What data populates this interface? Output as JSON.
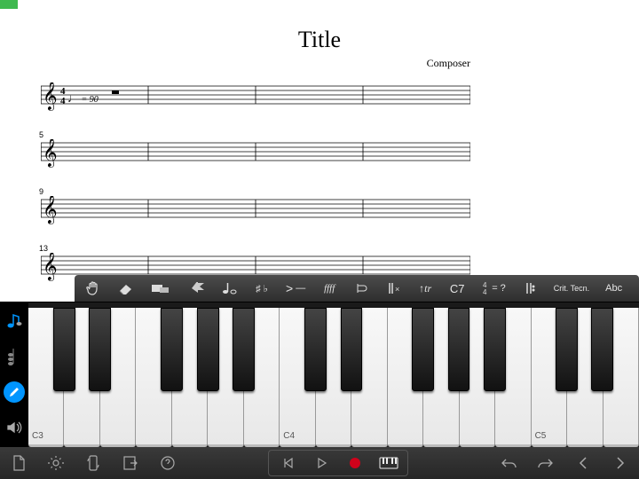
{
  "score": {
    "title": "Title",
    "composer": "Composer",
    "tempo": {
      "note": "♩",
      "equals": "=",
      "bpm": "90"
    },
    "time_sig": {
      "upper": "4",
      "lower": "4"
    },
    "rows": [
      {
        "measure_num": ""
      },
      {
        "measure_num": "5"
      },
      {
        "measure_num": "9"
      },
      {
        "measure_num": "13"
      }
    ]
  },
  "note_toolbar": {
    "hand": "hand-icon",
    "eraser": "eraser-icon",
    "select": "select-icon",
    "undo_arrow": "redo-icon",
    "note_values": "note-duration-icon",
    "accidentals": "♯ ♭",
    "dynamics_accent": ">",
    "dynamics_dash": "—",
    "dynamics_fff": "ffff",
    "clef_toggle": "clef-icon",
    "barline_x": "✕",
    "ornament": "↑tr",
    "chord_symbol": "C7",
    "time_sig_q": "= ?",
    "repeat_barline": "repeat-icon",
    "crit_text": "Crit. Tecn.",
    "lyric_abc": "Abc"
  },
  "left_rail": {
    "note_input": "note-input-icon",
    "chord_input": "chord-input-icon",
    "pencil": "pencil-icon",
    "sound": "volume-icon"
  },
  "keyboard": {
    "white_count": 17,
    "labels": {
      "0": "C3",
      "7": "C4",
      "14": "C5"
    },
    "black_positions_pct": [
      4.1,
      9.9,
      21.7,
      27.6,
      33.4,
      45.2,
      51.1,
      62.8,
      68.7,
      74.6,
      86.3,
      92.2
    ]
  },
  "bottom_bar": {
    "new_doc": "document-icon",
    "settings": "gear-icon",
    "phone": "rotate-device-icon",
    "export": "export-icon",
    "help": "help-icon",
    "rewind": "skip-back-icon",
    "play": "play-icon",
    "record": "record-icon",
    "keyboard_toggle": "piano-icon",
    "undo": "undo-icon",
    "redo": "redo-icon",
    "prev": "chevron-left-icon",
    "next": "chevron-right-icon"
  },
  "colors": {
    "accent": "#0095ff",
    "record": "#d0021b"
  }
}
